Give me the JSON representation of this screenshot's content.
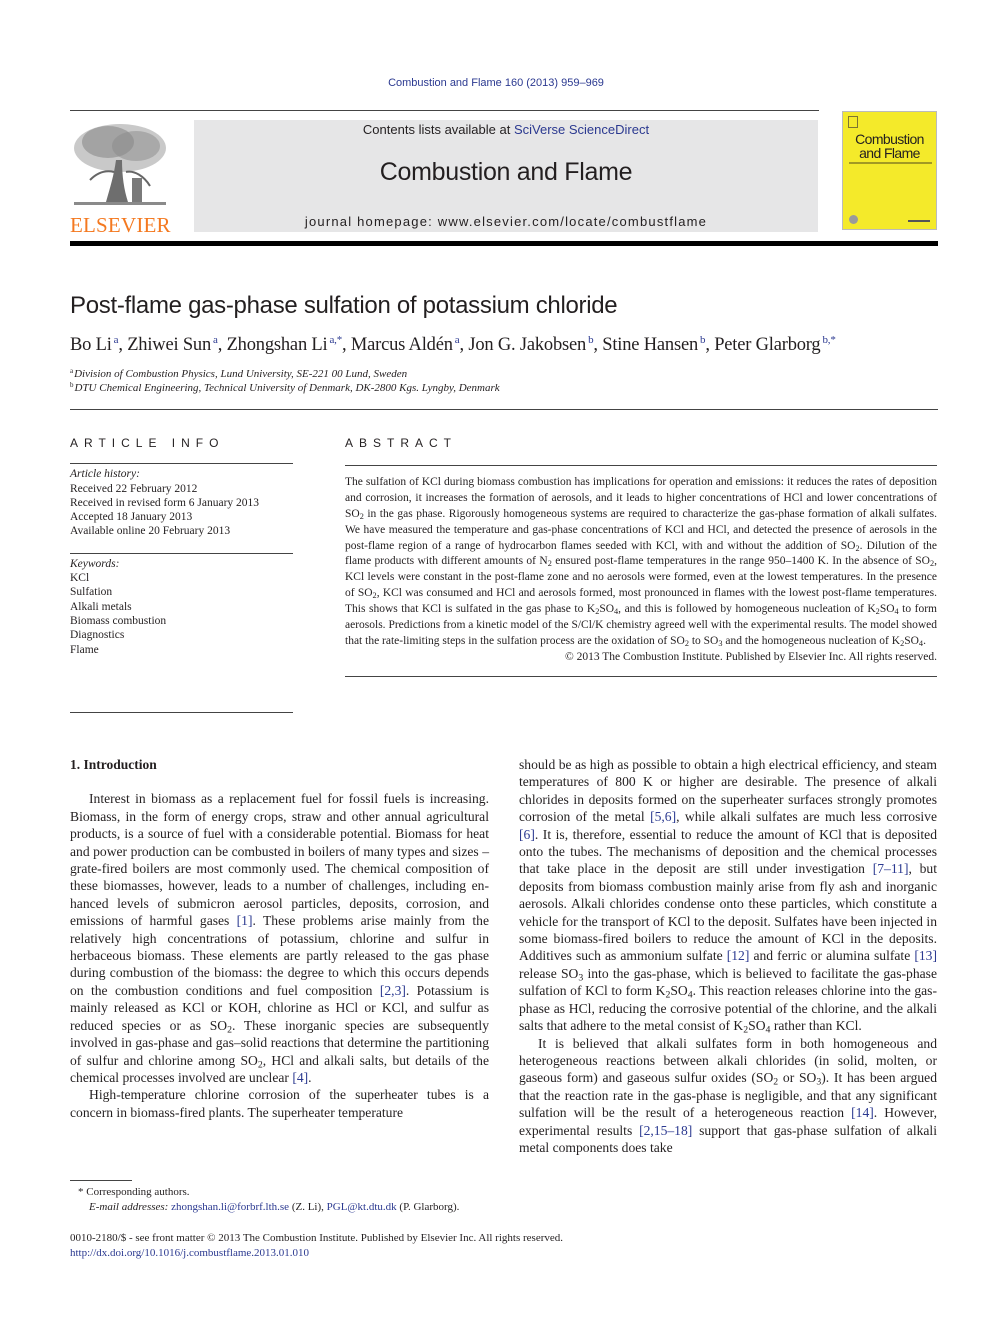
{
  "header": {
    "citation": "Combustion and Flame 160 (2013) 959–969",
    "contents_prefix": "Contents lists available at ",
    "contents_link": "SciVerse ScienceDirect",
    "journal_name": "Combustion and Flame",
    "homepage": "journal homepage: www.elsevier.com/locate/combustflame",
    "publisher_logo_text": "ELSEVIER",
    "cover_title_line1": "Combustion",
    "cover_title_line2": "and Flame",
    "colors": {
      "link": "#2b3990",
      "elsevier_orange": "#f47920",
      "cover_yellow": "#f4ea2a",
      "banner_grey": "#e6e6e7"
    }
  },
  "article": {
    "title": "Post-flame gas-phase sulfation of potassium chloride",
    "authors": [
      {
        "name": "Bo Li",
        "sup": "a"
      },
      {
        "name": "Zhiwei Sun",
        "sup": "a"
      },
      {
        "name": "Zhongshan Li",
        "sup": "a,*"
      },
      {
        "name": "Marcus Aldén",
        "sup": "a"
      },
      {
        "name": "Jon G. Jakobsen",
        "sup": "b"
      },
      {
        "name": "Stine Hansen",
        "sup": "b"
      },
      {
        "name": "Peter Glarborg",
        "sup": "b,*"
      }
    ],
    "affiliations": [
      {
        "mark": "a",
        "text": "Division of Combustion Physics, Lund University, SE-221 00 Lund, Sweden"
      },
      {
        "mark": "b",
        "text": "DTU Chemical Engineering, Technical University of Denmark, DK-2800 Kgs. Lyngby, Denmark"
      }
    ]
  },
  "article_info": {
    "heading": "ARTICLE INFO",
    "history_label": "Article history:",
    "history": [
      "Received 22 February 2012",
      "Received in revised form 6 January 2013",
      "Accepted 18 January 2013",
      "Available online 20 February 2013"
    ],
    "keywords_label": "Keywords:",
    "keywords": [
      "KCl",
      "Sulfation",
      "Alkali metals",
      "Biomass combustion",
      "Diagnostics",
      "Flame"
    ]
  },
  "abstract": {
    "heading": "ABSTRACT",
    "segments": [
      "The sulfation of KCl during biomass combustion has implications for operation and emissions: it reduces the rates of deposition and corrosion, it increases the formation of aerosols, and it leads to higher concentrations of HCl and lower concentrations of SO",
      "2",
      " in the gas phase. Rigorously homogeneous systems are required to characterize the gas-phase formation of alkali sulfates. We have measured the temperature and gas-phase concentrations of KCl and HCl, and detected the presence of aerosols in the post-flame region of a range of hydrocarbon flames seeded with KCl, with and without the addition of SO",
      "2",
      ". Dilution of the flame products with different amounts of N",
      "2",
      " ensured post-flame temperatures in the range 950–1400 K. In the absence of SO",
      "2",
      ", KCl levels were constant in the post-flame zone and no aerosols were formed, even at the lowest temperatures. In the presence of SO",
      "2",
      ", KCl was consumed and HCl and aerosols formed, most pronounced in flames with the lowest post-flame temperatures. This shows that KCl is sulfated in the gas phase to K",
      "2",
      "SO",
      "4",
      ", and this is followed by homogeneous nucleation of K",
      "2",
      "SO",
      "4",
      " to form aerosols. Predictions from a kinetic model of the S/Cl/K chemistry agreed well with the experimental results. The model showed that the rate-limiting steps in the sulfation process are the oxidation of SO",
      "2",
      " to SO",
      "3",
      " and the homogeneous nucleation of K",
      "2",
      "SO",
      "4",
      "."
    ],
    "copyright": "© 2013 The Combustion Institute. Published by Elsevier Inc. All rights reserved."
  },
  "intro": {
    "heading": "1. Introduction",
    "p1": {
      "a": "Interest in biomass as a replacement fuel for fossil fuels is increasing. Biomass, in the form of energy crops, straw and other annual agricultural products, is a source of fuel with a considerable potential. Biomass for heat and power production can be com­busted in boilers of many types and sizes – grate-fired boilers are most commonly used. The chemical composition of these bio­masses, however, leads to a number of challenges, including en­hanced levels of submicron aerosol particles, deposits, corrosion, and emissions of harmful gases ",
      "ref1": "[1]",
      "b": ". These problems arise mainly from the relatively high concentrations of potassium, chlorine and sulfur in herbaceous biomass. These elements are partly re­leased to the gas phase during combustion of the biomass: the de­gree to which this occurs depends on the combustion conditions and fuel composition ",
      "ref2": "[2,3]",
      "c": ". Potassium is mainly released as KCl or KOH, chlorine as HCl or KCl, and sulfur as reduced species or as SO",
      "c_sub": "2",
      "d": ". These inorganic species are subsequently involved in gas-phase and gas–solid reactions that determine the partitioning of sulfur and chlorine among SO",
      "d_sub": "2",
      "e": ", HCl and alkali salts, but details of the chemical processes involved are unclear ",
      "ref3": "[4]",
      "f": "."
    },
    "p2_left": "High-temperature chlorine corrosion of the superheater tubes is a concern in biomass-fired plants. The superheater temperature",
    "p2_right": {
      "a": "should be as high as possible to obtain a high electrical efficiency, and steam temperatures of 800 K or higher are desirable. The pres­ence of alkali chlorides in deposits formed on the superheater sur­faces strongly promotes corrosion of the metal ",
      "ref1": "[5,6]",
      "b": ", while alkali sulfates are much less corrosive ",
      "ref2": "[6]",
      "c": ". It is, therefore, essential to re­duce the amount of KCl that is deposited onto the tubes. The mech­anisms of deposition and the chemical processes that take place in the deposit are still under investigation ",
      "ref3": "[7–11]",
      "d": ", but deposits from biomass combustion mainly arise from fly ash and inorganic aero­sols. Alkali chlorides condense onto these particles, which consti­tute a vehicle for the transport of KCl to the deposit. Sulfates have been injected in some biomass-fired boilers to reduce the amount of KCl in the deposits. Additives such as ammonium sulfate ",
      "ref4": "[12]",
      "e": " and ferric or alumina sulfate ",
      "ref5": "[13]",
      "f": " release SO",
      "f_sub": "3",
      "g": " into the gas-phase, which is believed to facilitate the gas-phase sulfation of KCl to form K",
      "g_sub1": "2",
      "g2": "SO",
      "g_sub2": "4",
      "h": ". This reaction releases chlorine into the gas-phase as HCl, reducing the corrosive potential of the chlorine, and the alkali salts that adhere to the metal consist of K",
      "h_sub1": "2",
      "h2": "SO",
      "h_sub2": "4",
      "i": " rather than KCl."
    },
    "p3": {
      "a": "It is believed that alkali sulfates form in both homogeneous and heterogeneous reactions between alkali chlorides (in solid, molten, or gaseous form) and gaseous sulfur oxides (SO",
      "a_sub": "2",
      "b": " or SO",
      "b_sub": "3",
      "c": "). It has been argued that the reaction rate in the gas-phase is negligible, and that any significant sulfation will be the result of a heteroge­neous reaction ",
      "ref1": "[14]",
      "d": ". However, experimental results ",
      "ref2": "[2,15–18]",
      "e": " sup­port that gas-phase sulfation of alkali metal components does take"
    }
  },
  "footnotes": {
    "corresponding": "* Corresponding authors.",
    "email_label": "E-mail addresses:",
    "email1": "zhongshan.li@forbrf.lth.se",
    "email1_who": " (Z. Li), ",
    "email2": "PGL@kt.dtu.dk",
    "email2_who": " (P. Glarborg)."
  },
  "bottom": {
    "issn_line": "0010-2180/$ - see front matter © 2013 The Combustion Institute. Published by Elsevier Inc. All rights reserved.",
    "doi": "http://dx.doi.org/10.1016/j.combustflame.2013.01.010"
  }
}
